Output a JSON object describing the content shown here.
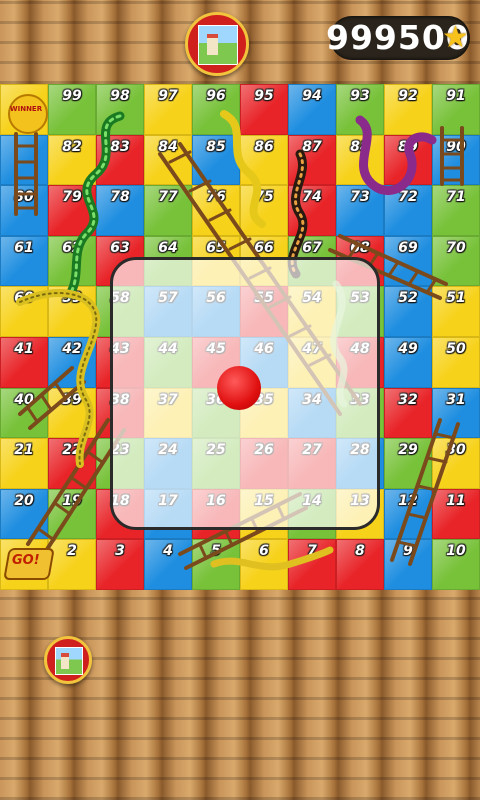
{
  "header": {
    "score": "999500",
    "star_icon": "star-icon"
  },
  "badges": {
    "winner": "WINNER",
    "go": "GO!"
  },
  "board": {
    "grid_columns": 10,
    "grid_rows": 10,
    "colors": {
      "red": "#e82428",
      "yellow": "#f7d21a",
      "green": "#78c23a",
      "blue": "#1f8ee0"
    },
    "cells": [
      {
        "n": "",
        "c": "yellow"
      },
      {
        "n": "99",
        "c": "green"
      },
      {
        "n": "98",
        "c": "green"
      },
      {
        "n": "97",
        "c": "yellow"
      },
      {
        "n": "96",
        "c": "green"
      },
      {
        "n": "95",
        "c": "red"
      },
      {
        "n": "94",
        "c": "blue"
      },
      {
        "n": "93",
        "c": "green"
      },
      {
        "n": "92",
        "c": "yellow"
      },
      {
        "n": "91",
        "c": "green"
      },
      {
        "n": "",
        "c": "blue"
      },
      {
        "n": "82",
        "c": "yellow"
      },
      {
        "n": "83",
        "c": "red"
      },
      {
        "n": "84",
        "c": "yellow"
      },
      {
        "n": "85",
        "c": "blue"
      },
      {
        "n": "86",
        "c": "yellow"
      },
      {
        "n": "87",
        "c": "red"
      },
      {
        "n": "88",
        "c": "yellow"
      },
      {
        "n": "89",
        "c": "red"
      },
      {
        "n": "90",
        "c": "blue"
      },
      {
        "n": "80",
        "c": "blue"
      },
      {
        "n": "79",
        "c": "red"
      },
      {
        "n": "78",
        "c": "blue"
      },
      {
        "n": "77",
        "c": "green"
      },
      {
        "n": "76",
        "c": "yellow"
      },
      {
        "n": "75",
        "c": "yellow"
      },
      {
        "n": "74",
        "c": "red"
      },
      {
        "n": "73",
        "c": "blue"
      },
      {
        "n": "72",
        "c": "blue"
      },
      {
        "n": "71",
        "c": "green"
      },
      {
        "n": "61",
        "c": "blue"
      },
      {
        "n": "62",
        "c": "green"
      },
      {
        "n": "63",
        "c": "red"
      },
      {
        "n": "64",
        "c": "green"
      },
      {
        "n": "65",
        "c": "yellow"
      },
      {
        "n": "66",
        "c": "yellow"
      },
      {
        "n": "67",
        "c": "green"
      },
      {
        "n": "68",
        "c": "red"
      },
      {
        "n": "69",
        "c": "blue"
      },
      {
        "n": "70",
        "c": "green"
      },
      {
        "n": "60",
        "c": "yellow"
      },
      {
        "n": "59",
        "c": "yellow"
      },
      {
        "n": "58",
        "c": "green"
      },
      {
        "n": "57",
        "c": "blue"
      },
      {
        "n": "56",
        "c": "blue"
      },
      {
        "n": "55",
        "c": "red"
      },
      {
        "n": "54",
        "c": "yellow"
      },
      {
        "n": "53",
        "c": "green"
      },
      {
        "n": "52",
        "c": "blue"
      },
      {
        "n": "51",
        "c": "yellow"
      },
      {
        "n": "41",
        "c": "red"
      },
      {
        "n": "42",
        "c": "blue"
      },
      {
        "n": "43",
        "c": "red"
      },
      {
        "n": "44",
        "c": "green"
      },
      {
        "n": "45",
        "c": "red"
      },
      {
        "n": "46",
        "c": "blue"
      },
      {
        "n": "47",
        "c": "yellow"
      },
      {
        "n": "48",
        "c": "red"
      },
      {
        "n": "49",
        "c": "blue"
      },
      {
        "n": "50",
        "c": "yellow"
      },
      {
        "n": "40",
        "c": "green"
      },
      {
        "n": "39",
        "c": "yellow"
      },
      {
        "n": "38",
        "c": "red"
      },
      {
        "n": "37",
        "c": "yellow"
      },
      {
        "n": "36",
        "c": "green"
      },
      {
        "n": "35",
        "c": "yellow"
      },
      {
        "n": "34",
        "c": "blue"
      },
      {
        "n": "33",
        "c": "green"
      },
      {
        "n": "32",
        "c": "red"
      },
      {
        "n": "31",
        "c": "blue"
      },
      {
        "n": "21",
        "c": "yellow"
      },
      {
        "n": "22",
        "c": "red"
      },
      {
        "n": "23",
        "c": "green"
      },
      {
        "n": "24",
        "c": "blue"
      },
      {
        "n": "25",
        "c": "green"
      },
      {
        "n": "26",
        "c": "red"
      },
      {
        "n": "27",
        "c": "red"
      },
      {
        "n": "28",
        "c": "blue"
      },
      {
        "n": "29",
        "c": "green"
      },
      {
        "n": "30",
        "c": "yellow"
      },
      {
        "n": "20",
        "c": "blue"
      },
      {
        "n": "19",
        "c": "green"
      },
      {
        "n": "18",
        "c": "red"
      },
      {
        "n": "17",
        "c": "blue"
      },
      {
        "n": "16",
        "c": "red"
      },
      {
        "n": "15",
        "c": "yellow"
      },
      {
        "n": "14",
        "c": "green"
      },
      {
        "n": "13",
        "c": "yellow"
      },
      {
        "n": "12",
        "c": "blue"
      },
      {
        "n": "11",
        "c": "red"
      },
      {
        "n": "",
        "c": "yellow"
      },
      {
        "n": "2",
        "c": "yellow"
      },
      {
        "n": "3",
        "c": "red"
      },
      {
        "n": "4",
        "c": "blue"
      },
      {
        "n": "5",
        "c": "green"
      },
      {
        "n": "6",
        "c": "yellow"
      },
      {
        "n": "7",
        "c": "red"
      },
      {
        "n": "8",
        "c": "red"
      },
      {
        "n": "9",
        "c": "blue"
      },
      {
        "n": "10",
        "c": "green"
      }
    ]
  },
  "dice": {
    "face_value": 1
  },
  "players": {
    "opponent_avatar_icon": "castle-avatar-icon",
    "player_avatar_icon": "castle-avatar-icon"
  }
}
